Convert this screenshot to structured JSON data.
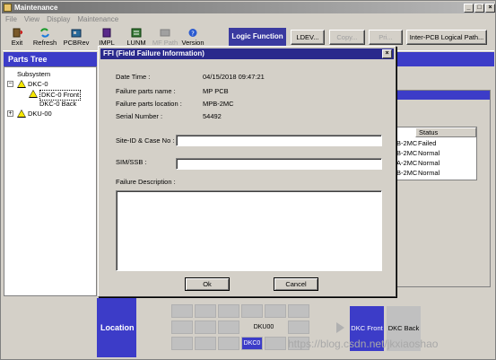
{
  "app": {
    "title": "Maintenance"
  },
  "menu": [
    "File",
    "View",
    "Display",
    "Maintenance"
  ],
  "toolbar": {
    "exit": "Exit",
    "refresh": "Refresh",
    "pcbrev": "PCBRev",
    "impl": "IMPL",
    "lunm": "LUNM",
    "mf_path": "MF Path",
    "version": "Version",
    "logic_function": "Logic Function",
    "ldev": "LDEV...",
    "copy": "Copy...",
    "pri": "Pri...",
    "inter_pcb": "Inter-PCB Logical Path..."
  },
  "parts_tree": {
    "header": "Parts Tree",
    "root": "Subsystem",
    "dkc0": "DKC-0",
    "dkc0_front": "DKC-0 Front",
    "dkc0_back": "DKC-0 Back",
    "dku00": "DKU-00"
  },
  "status_table": {
    "col_status": "Status",
    "rows": [
      {
        "name": "B-2MC",
        "status": "Failed"
      },
      {
        "name": "B-2MC",
        "status": "Normal"
      },
      {
        "name": "A-2MC",
        "status": "Normal"
      },
      {
        "name": "B-2MC",
        "status": "Normal"
      }
    ]
  },
  "location": {
    "label": "Location",
    "dku00": "DKU00",
    "dkc0": "DKC0",
    "dkc_front": "DKC Front",
    "dkc_back": "DKC Back"
  },
  "dialog": {
    "title": "FFI (Field Failure Information)",
    "date_label": "Date Time :",
    "date_value": "04/15/2018 09:47:21",
    "failure_name_label": "Failure parts name :",
    "failure_name_value": "MP PCB",
    "failure_location_label": "Failure parts location :",
    "failure_location_value": "MPB-2MC",
    "serial_label": "Serial Number :",
    "serial_value": "54492",
    "site_label": "Site-ID & Case No :",
    "sim_label": "SIM/SSB :",
    "desc_label": "Failure Description :",
    "ok": "Ok",
    "cancel": "Cancel"
  },
  "watermark": "https://blog.csdn.net/jkxiaoshao"
}
